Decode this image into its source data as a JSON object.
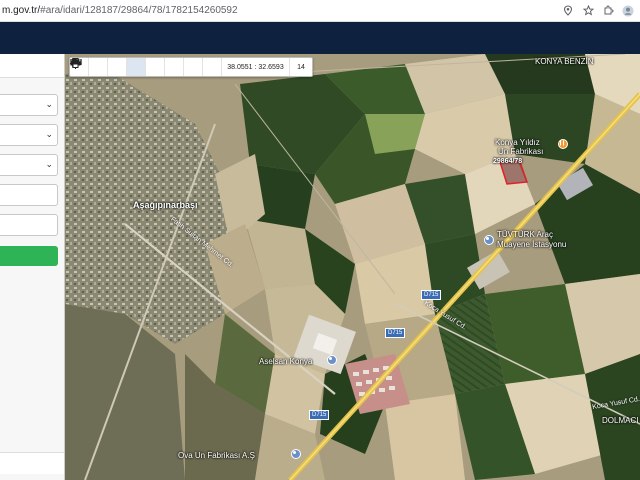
{
  "browser": {
    "url_host": "m.gov.tr/",
    "url_path": "#ara/idari/128187/29864/78/1782154260592",
    "icons": [
      "location-icon",
      "star-icon",
      "extension-icon",
      "profile-icon"
    ]
  },
  "map": {
    "coordinates": "38.0551 : 32.6593",
    "zoom": "14",
    "toolbar_icons": [
      "zoom-in-icon",
      "zoom-out-icon",
      "refresh-icon",
      "locate-icon",
      "info-icon",
      "star-icon",
      "measure-icon",
      "print-icon"
    ],
    "labels": {
      "village": "Aşağıpınarbaşı",
      "konya_benzin": "KONYA BENZİN",
      "yildiz_line1": "Konya Yıldız",
      "yildiz_line2": "Un Fabrikası",
      "tuvturk_line1": "TÜVTÜRK Araç",
      "tuvturk_line2": "Muayene İstasyonu",
      "aselsan": "Aselsan Konya",
      "ova_un": "Ova Un Fabrikası A.Ş",
      "dolmaci": "DOLMACI YA",
      "koca_yusuf_1": "Koca Yusuf Cd.",
      "koca_yusuf_2": "Koca Yusuf Cd.",
      "fatih_sultan": "Fatih Sultan Mehmet Cd.",
      "parcel": "29864/78",
      "d715_a": "D715",
      "d715_b": "D715",
      "d715_c": "D715"
    }
  },
  "colors": {
    "header": "#0e2240",
    "sidebar_button": "#2eb357",
    "parcel_outline": "#e0202a"
  }
}
